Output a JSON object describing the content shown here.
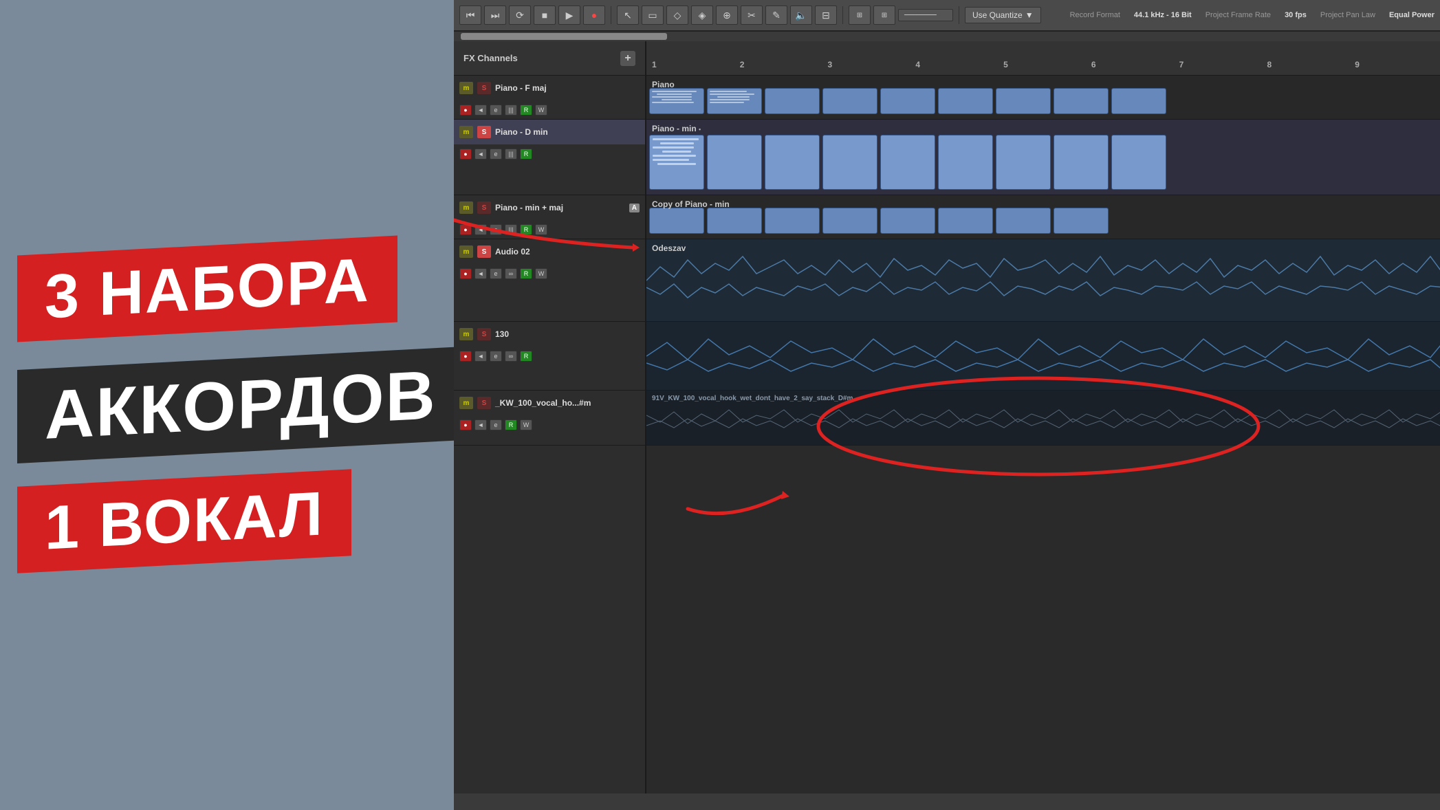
{
  "left": {
    "line1": "3 НАБОРА",
    "line2": "АККОРДОВ",
    "line3": "1 ВОКАЛ"
  },
  "toolbar": {
    "record_format_label": "Record Format",
    "record_format_value": "44.1 kHz - 16 Bit",
    "frame_rate_label": "Project Frame Rate",
    "frame_rate_value": "30 fps",
    "pan_law_label": "Project Pan Law",
    "pan_law_value": "Equal Power",
    "use_quantize": "Use Quantize"
  },
  "tracks": {
    "header": "FX Channels",
    "add_btn": "+",
    "items": [
      {
        "name": "Piano - F maj",
        "m": "m",
        "s": "s",
        "has_controls": true,
        "active": false
      },
      {
        "name": "Piano - D min",
        "m": "m",
        "s": "s",
        "has_controls": true,
        "active": true
      },
      {
        "name": "Piano - min + maj",
        "label": "A",
        "m": "m",
        "s": "s",
        "has_controls": true,
        "active": false
      },
      {
        "name": "Audio 02",
        "m": "m",
        "s": "s",
        "has_controls": true,
        "active": false
      },
      {
        "name": "130",
        "m": "m",
        "s": "s",
        "has_controls": true,
        "active": false
      },
      {
        "name": "_KW_100_vocal_ho...#m",
        "m": "m",
        "s": "s",
        "has_controls": true,
        "active": false
      }
    ]
  },
  "ruler": {
    "numbers": [
      "1",
      "2",
      "3",
      "4",
      "5",
      "6",
      "7",
      "8",
      "9"
    ]
  },
  "lanes": [
    {
      "label": "Piano",
      "type": "piano"
    },
    {
      "label": "Piano - min",
      "type": "piano"
    },
    {
      "label": "Copy of Piano - min",
      "type": "piano"
    },
    {
      "label": "Odeszav",
      "type": "audio"
    },
    {
      "label": "",
      "type": "audio2"
    },
    {
      "label": "91V_KW_100_vocal_hook_wet_dont_have_2_say_stack_D#m",
      "type": "audio3"
    }
  ]
}
